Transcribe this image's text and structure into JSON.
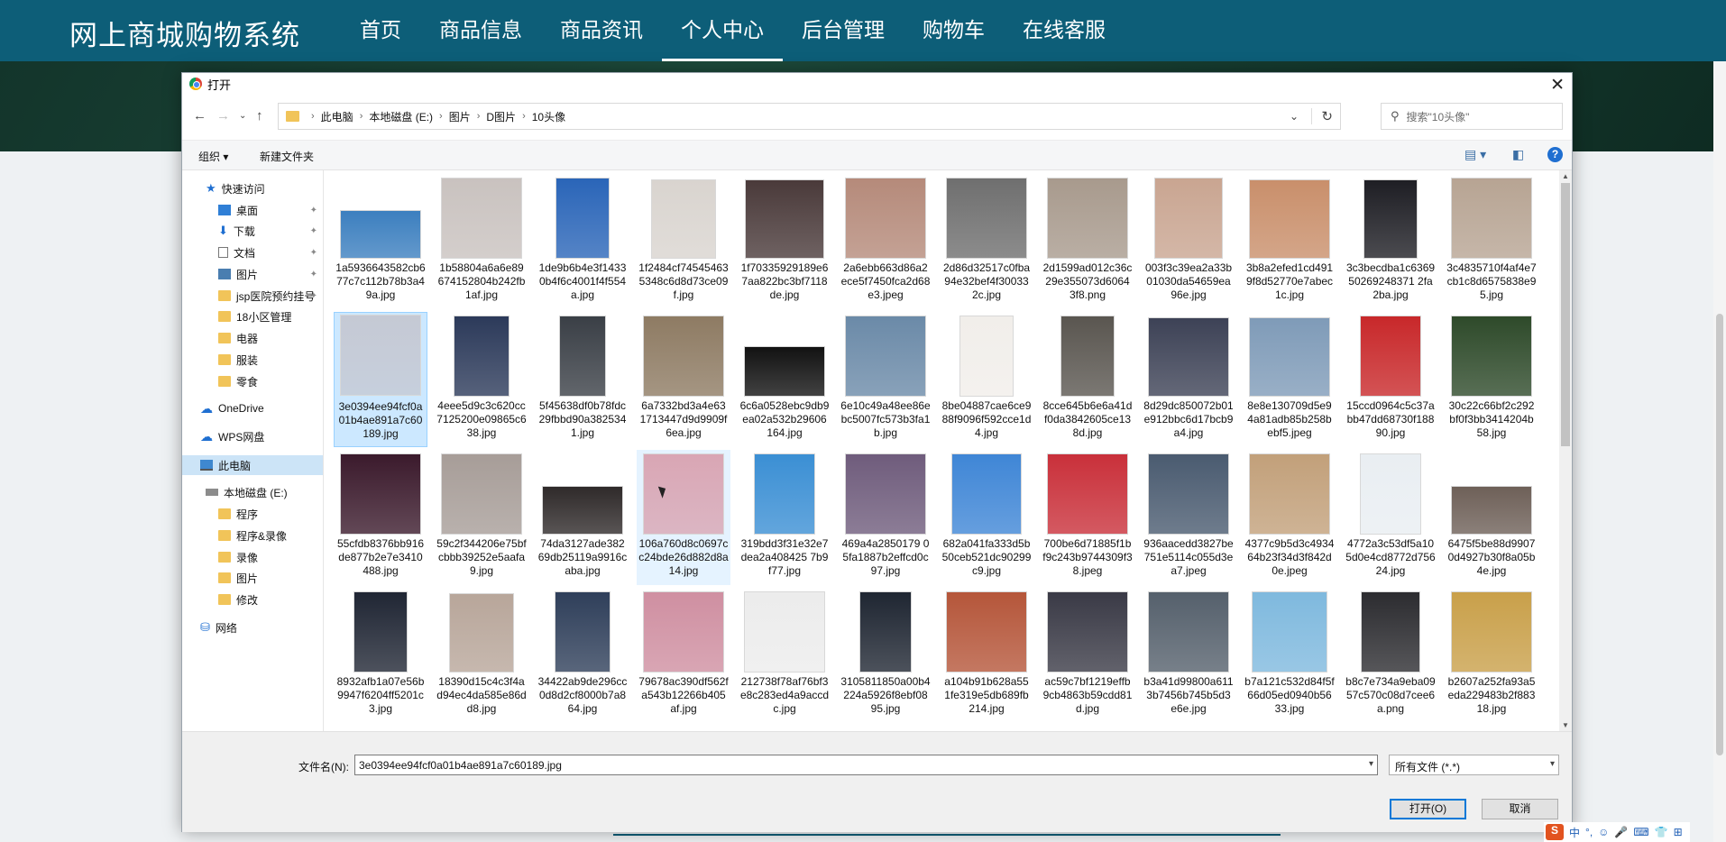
{
  "site": {
    "brand": "网上商城购物系统",
    "menu": [
      "首页",
      "商品信息",
      "商品资讯",
      "个人中心",
      "后台管理",
      "购物车",
      "在线客服"
    ],
    "active_menu": "个人中心",
    "nav_color": "#0d5e78"
  },
  "dialog": {
    "title": "打开",
    "close": "✕",
    "breadcrumb": [
      "此电脑",
      "本地磁盘 (E:)",
      "图片",
      "D图片",
      "10头像"
    ],
    "search_placeholder": "搜索\"10头像\"",
    "toolbar": {
      "organize": "组织 ▾",
      "new_folder": "新建文件夹",
      "help": "?"
    },
    "sidebar": [
      {
        "label": "快速访问",
        "icon": "star-icon"
      },
      {
        "label": "桌面",
        "icon": "desktop-icon",
        "pinned": true
      },
      {
        "label": "下载",
        "icon": "download-icon",
        "pinned": true
      },
      {
        "label": "文档",
        "icon": "document-icon",
        "pinned": true
      },
      {
        "label": "图片",
        "icon": "pictures-icon",
        "pinned": true
      },
      {
        "label": "jsp医院预约挂号",
        "icon": "folder-icon",
        "pinned": true
      },
      {
        "label": "18小区管理",
        "icon": "folder-icon"
      },
      {
        "label": "电器",
        "icon": "folder-icon"
      },
      {
        "label": "服装",
        "icon": "folder-icon"
      },
      {
        "label": "零食",
        "icon": "folder-icon"
      },
      {
        "label": "OneDrive",
        "icon": "cloud-icon"
      },
      {
        "label": "WPS网盘",
        "icon": "cloud-icon"
      },
      {
        "label": "此电脑",
        "icon": "computer-icon",
        "selected": true
      },
      {
        "label": "本地磁盘 (E:)",
        "icon": "drive-icon"
      },
      {
        "label": "程序",
        "icon": "folder-icon"
      },
      {
        "label": "程序&录像",
        "icon": "folder-icon"
      },
      {
        "label": "录像",
        "icon": "folder-icon"
      },
      {
        "label": "图片",
        "icon": "folder-icon"
      },
      {
        "label": "修改",
        "icon": "folder-icon"
      },
      {
        "label": "网络",
        "icon": "network-icon"
      }
    ],
    "files": [
      {
        "name": "1a5936643582cb677c7c112b78b3a49a.jpg",
        "color": "#3c7fbf"
      },
      {
        "name": "1b58804a6a6e89674152804b242fb1af.jpg",
        "color": "#c9c2bf"
      },
      {
        "name": "1de9b6b4e3f14330b4f6c4001f4f554a.jpg",
        "color": "#2a65b8"
      },
      {
        "name": "1f2484cf745454635348c6d8d73ce09f.jpg",
        "color": "#d9d4cf"
      },
      {
        "name": "1f70335929189e67aa822bc3bf7118de.jpg",
        "color": "#4a3a3a"
      },
      {
        "name": "2a6ebb663d86a2ece5f7450fca2d68e3.jpeg",
        "color": "#b58a7a"
      },
      {
        "name": "2d86d32517c0fba94e32bef4f300332c.jpg",
        "color": "#6f6f6f"
      },
      {
        "name": "2d1599ad012c36c29e355073d60643f8.png",
        "color": "#a89a8d"
      },
      {
        "name": "003f3c39ea2a33b01030da54659ea96e.jpg",
        "color": "#c9a591"
      },
      {
        "name": "3b8a2efed1cd4919f8d52770e7abec1c.jpg",
        "color": "#c98f6b"
      },
      {
        "name": "3c3becdba1c636950269248371 2fa2ba.jpg",
        "color": "#1e1e24"
      },
      {
        "name": "3c4835710f4af4e7cb1c8d6575838e95.jpg",
        "color": "#b7a493"
      },
      {
        "name": "3e0394ee94fcf0a01b4ae891a7c60189.jpg",
        "color": "#c5c9d4",
        "selected": true
      },
      {
        "name": "4eee5d9c3c620cc7125200e09865c638.jpg",
        "color": "#2c3a5a"
      },
      {
        "name": "5f45638df0b78fdc29fbbd90a3825341.jpg",
        "color": "#3a3f46"
      },
      {
        "name": "6a7332bd3a4e631713447d9d9909f6ea.jpg",
        "color": "#8e7b63"
      },
      {
        "name": "6c6a0528ebc9db9ea02a532b29606164.jpg",
        "color": "#121212"
      },
      {
        "name": "6e10c49a48ee86ebc5007fc573b3fa1b.jpg",
        "color": "#6b8aa8"
      },
      {
        "name": "8be04887cae6ce988f9096f592cce1d4.jpg",
        "color": "#f1eeea"
      },
      {
        "name": "8cce645b6e6a41df0da3842605ce138d.jpg",
        "color": "#5a5650"
      },
      {
        "name": "8d29dc850072b01e912bbc6d17bcb9a4.jpg",
        "color": "#3d4256"
      },
      {
        "name": "8e8e130709d5e94a81adb85b258bebf5.jpeg",
        "color": "#7f9bb8"
      },
      {
        "name": "15ccd0964c5c37abb47dd68730f18890.jpg",
        "color": "#c8282a"
      },
      {
        "name": "30c22c66bf2c292bf0f3bb3414204b58.jpg",
        "color": "#2e4a2a"
      },
      {
        "name": "55cfdb8376bb916de877b2e7e3410488.jpg",
        "color": "#3b1a2c"
      },
      {
        "name": "59c2f344206e75bfcbbb39252e5aafa9.jpg",
        "color": "#a79d98"
      },
      {
        "name": "74da3127ade38269db25119a9916caba.jpg",
        "color": "#2f2a2a"
      },
      {
        "name": "106a760d8c0697cc24bde26d882d8a14.jpg",
        "color": "#d9a6b4",
        "hover": true
      },
      {
        "name": "319bdd3f31e32e7dea2a408425 7b9f77.jpg",
        "color": "#3b8fd4"
      },
      {
        "name": "469a4a2850179 05fa1887b2effcd0c97.jpg",
        "color": "#6f5c7c"
      },
      {
        "name": "682a041fa333d5b50ceb521dc90299c9.jpg",
        "color": "#3f86d6"
      },
      {
        "name": "700be6d71885f1bf9c243b9744309f38.jpeg",
        "color": "#c9303a"
      },
      {
        "name": "936aacedd3827be751e5114c055d3ea7.jpeg",
        "color": "#4a5b70"
      },
      {
        "name": "4377c9b5d3c493464b23f34d3f842d0e.jpeg",
        "color": "#c2a07a"
      },
      {
        "name": "4772a3c53df5a105d0e4cd8772d75624.jpg",
        "color": "#e9eef2"
      },
      {
        "name": "6475f5be88d99070d4927b30f8a05b4e.jpg",
        "color": "#6e6058"
      },
      {
        "name": "8932afb1a07e56b9947f6204ff5201c3.jpg",
        "color": "#202634"
      },
      {
        "name": "18390d15c4c3f4ad94ec4da585e86dd8.jpg",
        "color": "#b8a69a"
      },
      {
        "name": "34422ab9de296cc0d8d2cf8000b7a864.jpg",
        "color": "#2f3f5a"
      },
      {
        "name": "79678ac390df562fa543b12266b405af.jpg",
        "color": "#cf8fa1"
      },
      {
        "name": "212738f78af76bf3e8c283ed4a9accdc.jpg",
        "color": "#ececec"
      },
      {
        "name": "3105811850a00b4224a5926f8ebf0895.jpg",
        "color": "#1f2632"
      },
      {
        "name": "a104b91b628a551fe319e5db689fb214.jpg",
        "color": "#b5563a"
      },
      {
        "name": "ac59c7bf1219effb9cb4863b59cdd81d.jpg",
        "color": "#3a3a46"
      },
      {
        "name": "b3a41d99800a6113b7456b745b5d3e6e.jpg",
        "color": "#55606c"
      },
      {
        "name": "b7a121c532d84f5f66d05ed0940b5633.jpg",
        "color": "#7fb9de"
      },
      {
        "name": "b8c7e734a9eba0957c570c08d7cee6a.png",
        "color": "#2c2c30"
      },
      {
        "name": "b2607a252fa93a5eda229483b2f88318.jpg",
        "color": "#c9a04a"
      },
      {
        "name": "",
        "color": "#2f3436"
      },
      {
        "name": "",
        "color": "#b89a8c"
      },
      {
        "name": "",
        "color": "#c2a8a0"
      },
      {
        "name": "",
        "color": "#a27a4a"
      },
      {
        "name": "",
        "color": "#c3a08a"
      },
      {
        "name": "",
        "color": "#d8d0ca"
      },
      {
        "name": "",
        "color": "#202020"
      },
      {
        "name": "",
        "color": "#8a6a5a"
      },
      {
        "name": "",
        "color": "#d08a7a"
      },
      {
        "name": "",
        "color": "#3a6ab0"
      },
      {
        "name": "",
        "color": "#3f86d6"
      }
    ],
    "filename_label": "文件名(N):",
    "filename_value": "3e0394ee94fcf0a01b4ae891a7c60189.jpg",
    "filetype": "所有文件 (*.*)",
    "open_button": "打开(O)",
    "cancel_button": "取消"
  },
  "tray": {
    "ime": "S",
    "lang": "中",
    "items": [
      "°,",
      "☺",
      "🎤",
      "⌨",
      "👕",
      "⊞"
    ]
  }
}
